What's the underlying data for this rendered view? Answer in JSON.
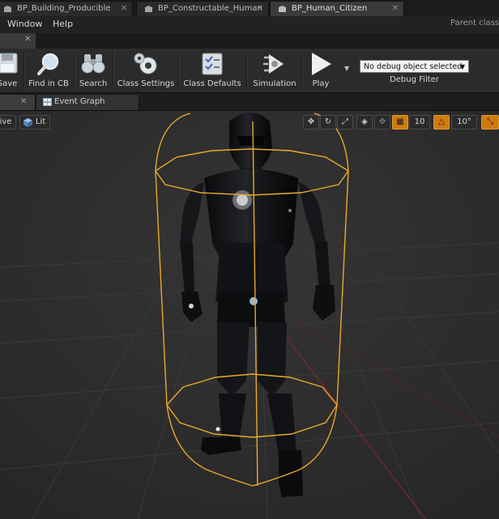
{
  "tabs": [
    {
      "label": "BP_Building_Producible",
      "active": false
    },
    {
      "label": "BP_Constructable_Human",
      "active": false
    },
    {
      "label": "BP_Human_Citizen",
      "active": true
    }
  ],
  "menu": {
    "items": [
      "Window",
      "Help"
    ],
    "parent_class": "Parent class"
  },
  "toolbar": {
    "buttons": [
      {
        "label": "Save",
        "icon": "save-icon"
      },
      {
        "label": "Find in CB",
        "icon": "magnifier-icon"
      },
      {
        "label": "Search",
        "icon": "binoculars-icon"
      },
      {
        "label": "Class Settings",
        "icon": "gears-icon"
      },
      {
        "label": "Class Defaults",
        "icon": "checklist-icon"
      },
      {
        "label": "Simulation",
        "icon": "simulation-icon"
      },
      {
        "label": "Play",
        "icon": "play-icon"
      }
    ],
    "debug_object": "No debug object selected",
    "debug_filter_label": "Debug Filter"
  },
  "editor_tabs": [
    {
      "label": "",
      "icon": "graph-tab-icon",
      "closable": true
    },
    {
      "label": "Event Graph",
      "icon": "event-graph-icon",
      "closable": false
    }
  ],
  "viewport": {
    "view_mode_label": "ive",
    "lit_label": "Lit",
    "grid_snap_value": "10",
    "rotation_snap_value": "10°",
    "colors": {
      "capsule": "#e8a92a",
      "snap_active": "#d07a10",
      "background": "#303030"
    }
  }
}
